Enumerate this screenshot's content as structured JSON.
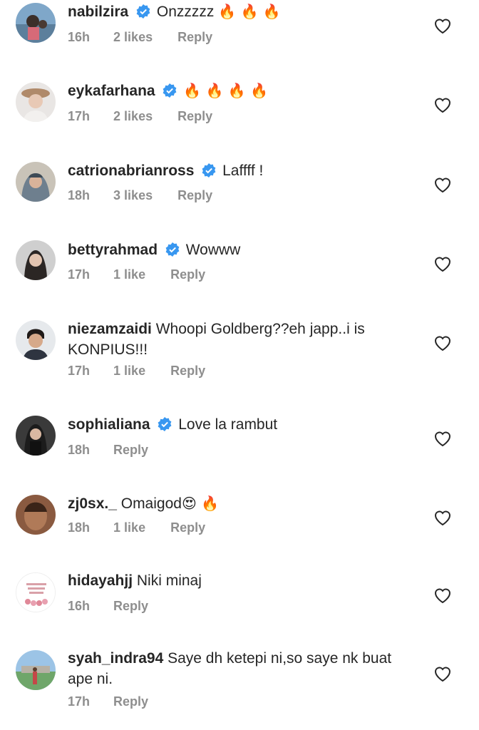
{
  "comments": [
    {
      "username": "nabilzira",
      "verified": true,
      "text": "Onzzzzz",
      "emoji": "🔥 🔥 🔥",
      "time": "16h",
      "likes": "2 likes",
      "reply": "Reply"
    },
    {
      "username": "eykafarhana",
      "verified": true,
      "text": "",
      "emoji": "🔥 🔥 🔥 🔥",
      "time": "17h",
      "likes": "2 likes",
      "reply": "Reply"
    },
    {
      "username": "catrionabrianross",
      "verified": true,
      "text": "Laffff !",
      "emoji": "",
      "time": "18h",
      "likes": "3 likes",
      "reply": "Reply"
    },
    {
      "username": "bettyrahmad",
      "verified": true,
      "text": "Wowww",
      "emoji": "",
      "time": "17h",
      "likes": "1 like",
      "reply": "Reply"
    },
    {
      "username": "niezamzaidi",
      "verified": false,
      "text": "Whoopi Goldberg??eh japp..i is KONPIUS!!!",
      "emoji": "",
      "time": "17h",
      "likes": "1 like",
      "reply": "Reply"
    },
    {
      "username": "sophialiana",
      "verified": true,
      "text": "Love la rambut",
      "emoji": "",
      "time": "18h",
      "likes": "",
      "reply": "Reply"
    },
    {
      "username": "zj0sx._",
      "verified": false,
      "text": "Omaigod",
      "emoji": "😍 🔥",
      "time": "18h",
      "likes": "1 like",
      "reply": "Reply"
    },
    {
      "username": "hidayahjj",
      "verified": false,
      "text": "Niki minaj",
      "emoji": "",
      "time": "16h",
      "likes": "",
      "reply": "Reply"
    },
    {
      "username": "syah_indra94",
      "verified": false,
      "text": "Saye dh ketepi ni,so saye nk buat ape ni.",
      "emoji": "",
      "time": "17h",
      "likes": "",
      "reply": "Reply"
    }
  ],
  "icons": {
    "verified": "verified-badge-icon",
    "like": "heart-outline-icon"
  },
  "colors": {
    "verified": "#3897f0",
    "meta": "#8e8e8e",
    "text": "#262626"
  }
}
